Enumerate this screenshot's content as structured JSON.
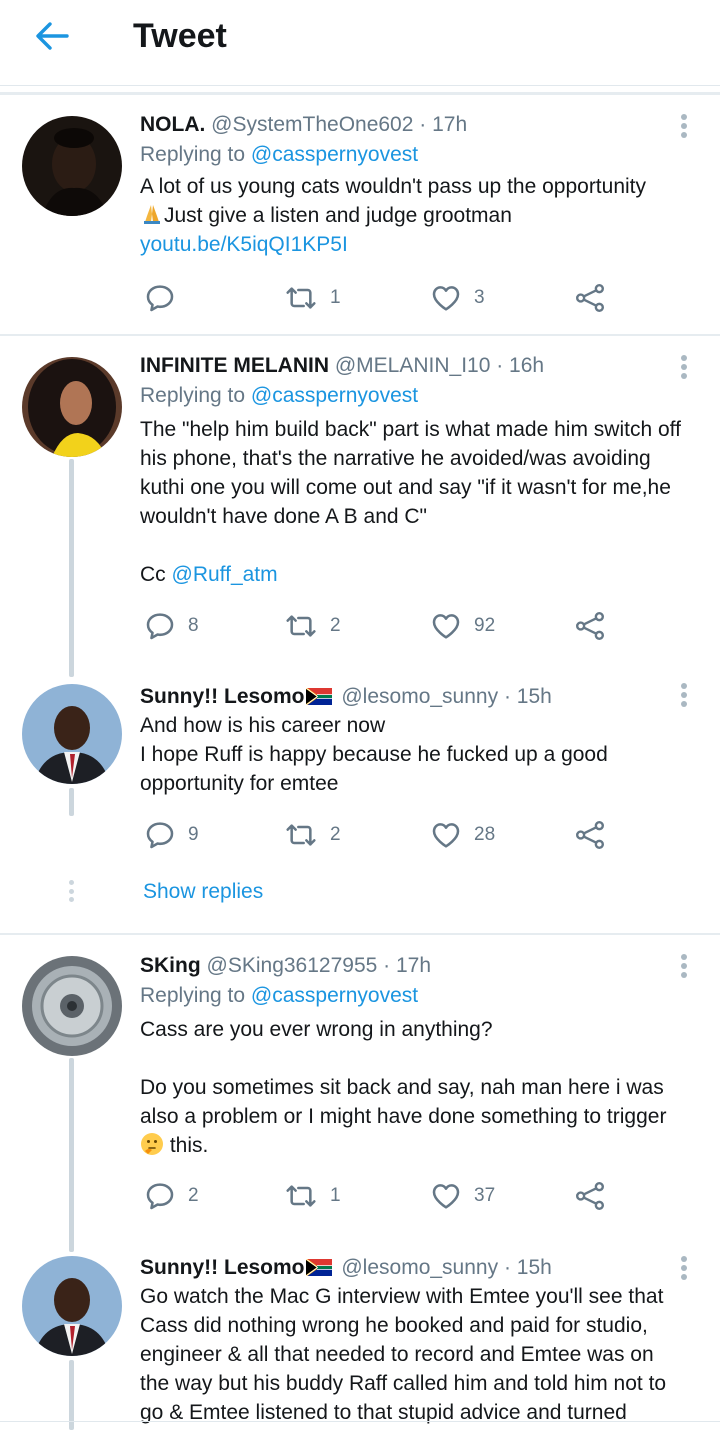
{
  "header": {
    "title": "Tweet",
    "back_icon": "arrow-left-icon"
  },
  "colors": {
    "accent": "#1b95e0",
    "secondary_text": "#657786",
    "icon": "#657786"
  },
  "tweets": [
    {
      "name": "NOLA.",
      "handle": "@SystemTheOne602",
      "time": "· 17h",
      "replying_label": "Replying to ",
      "replying_to": "@casspernyovest",
      "text1": "A lot of us young cats wouldn't pass up the opportunity",
      "text2": "Just give a listen and judge grootman",
      "link": "youtu.be/K5iqQI1KP5I",
      "replies": "",
      "retweets": "1",
      "likes": "3"
    },
    {
      "name": "INFINITE MELANIN",
      "handle": "@MELANIN_I10",
      "time": "· 16h",
      "replying_label": "Replying to ",
      "replying_to": "@casspernyovest",
      "text1": "The \"help him build back\" part is what made him switch off his phone, that's the narrative he avoided/was avoiding kuthi one you will come out and say \"if it wasn't for me,he wouldn't have done A B and C\"",
      "cc_label": "Cc ",
      "cc_mention": "@Ruff_atm",
      "replies": "8",
      "retweets": "2",
      "likes": "92"
    },
    {
      "name": "Sunny!! Lesomo",
      "handle": "@lesomo_sunny",
      "time": "· 15h",
      "text1": "And how is his career now",
      "text2": "I hope Ruff is happy because he fucked up a good opportunity for emtee",
      "replies": "9",
      "retweets": "2",
      "likes": "28",
      "show_replies": "Show replies"
    },
    {
      "name": "SKing",
      "handle": "@SKing36127955",
      "time": "· 17h",
      "replying_label": "Replying to ",
      "replying_to": "@casspernyovest",
      "text1": "Cass are you ever wrong in anything?",
      "text2": "Do you sometimes sit back and say, nah man here i was also a problem or I might have done something to trigger",
      "text3": " this.",
      "replies": "2",
      "retweets": "1",
      "likes": "37"
    },
    {
      "name": "Sunny!! Lesomo",
      "handle": "@lesomo_sunny",
      "time": "· 15h",
      "text1": "Go watch the Mac G interview with Emtee you'll see that Cass did nothing wrong he booked and paid for studio, engineer & all that needed to record and Emtee was on the way but his buddy Raff called him and told him not to go & Emtee listened to that stupid advice and turned"
    }
  ]
}
